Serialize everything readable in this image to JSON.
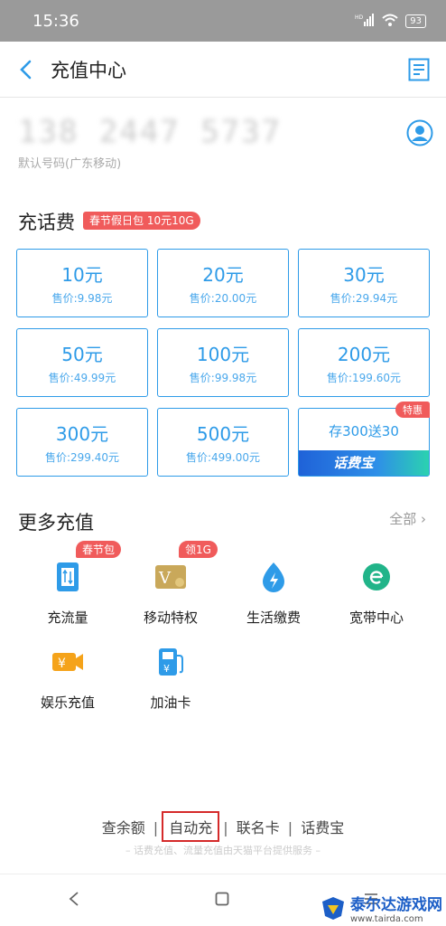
{
  "status_bar": {
    "time": "15:36",
    "network": "HD",
    "battery": "93"
  },
  "header": {
    "title": "充值中心"
  },
  "account": {
    "number": "138 2447 5737",
    "subtitle": "默认号码(广东移动)"
  },
  "recharge": {
    "title": "充话费",
    "promo": "春节假日包 10元10G",
    "options": [
      {
        "amount": "10元",
        "price": "售价:9.98元"
      },
      {
        "amount": "20元",
        "price": "售价:20.00元"
      },
      {
        "amount": "30元",
        "price": "售价:29.94元"
      },
      {
        "amount": "50元",
        "price": "售价:49.99元"
      },
      {
        "amount": "100元",
        "price": "售价:99.98元"
      },
      {
        "amount": "200元",
        "price": "售价:199.60元"
      },
      {
        "amount": "300元",
        "price": "售价:299.40元"
      },
      {
        "amount": "500元",
        "price": "售价:499.00元"
      }
    ],
    "special": {
      "text": "存300送30",
      "banner": "话费宝",
      "badge": "特惠"
    }
  },
  "more": {
    "title": "更多充值",
    "all": "全部",
    "items": [
      {
        "label": "充流量",
        "tag": "春节包",
        "icon": "data-traffic-icon"
      },
      {
        "label": "移动特权",
        "tag": "领1G",
        "icon": "vip-privilege-icon"
      },
      {
        "label": "生活缴费",
        "tag": "",
        "icon": "utility-bill-icon"
      },
      {
        "label": "宽带中心",
        "tag": "",
        "icon": "broadband-icon"
      },
      {
        "label": "娱乐充值",
        "tag": "",
        "icon": "entertainment-icon"
      },
      {
        "label": "加油卡",
        "tag": "",
        "icon": "fuel-card-icon"
      }
    ]
  },
  "footer": {
    "links": [
      "查余额",
      "自动充",
      "联名卡",
      "话费宝"
    ],
    "note": "– 话费充值、流量充值由天猫平台提供服务 –"
  },
  "watermark": {
    "brand": "泰尔达游戏网",
    "url": "www.tairda.com"
  },
  "colors": {
    "accent": "#2e9be8",
    "tag_red": "#f05b5b",
    "highlight_box": "#d52a2a"
  }
}
